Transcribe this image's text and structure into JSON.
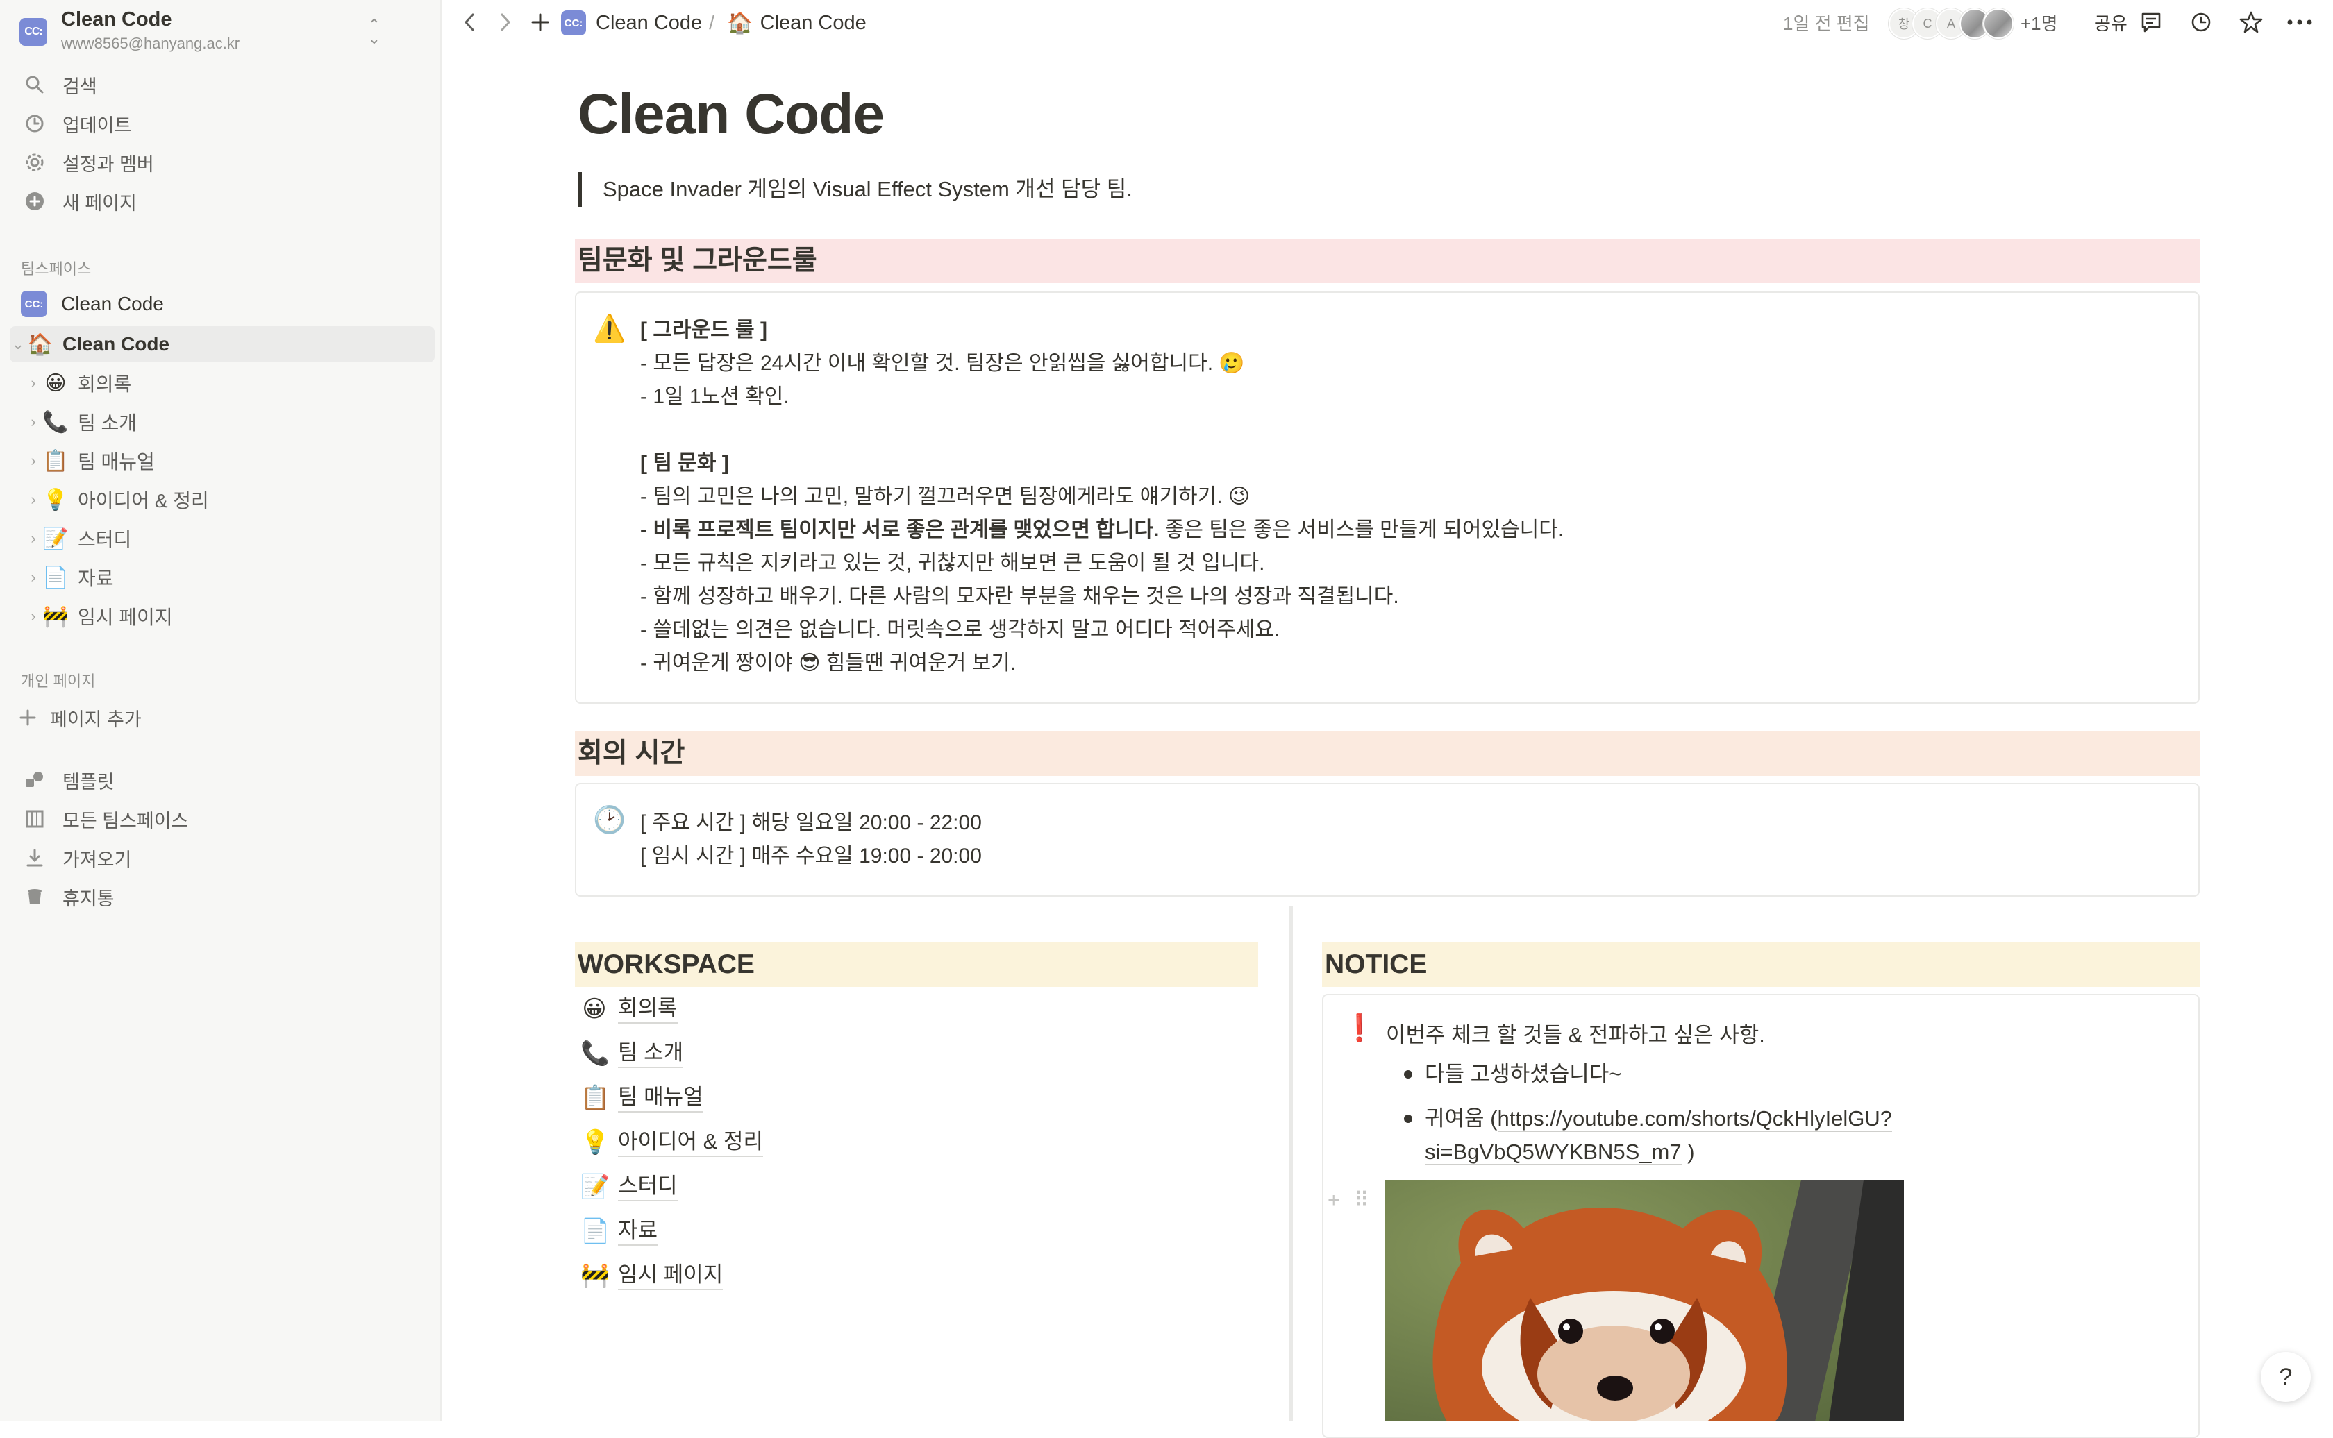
{
  "sidebar": {
    "workspace": {
      "name": "Clean Code",
      "email": "www8565@hanyang.ac.kr",
      "logo_text": "CC:"
    },
    "nav": [
      {
        "label": "검색",
        "icon": "search-icon"
      },
      {
        "label": "업데이트",
        "icon": "clock-icon"
      },
      {
        "label": "설정과 멤버",
        "icon": "gear-icon"
      },
      {
        "label": "새 페이지",
        "icon": "plus-circle-icon"
      }
    ],
    "teamspace_label": "팀스페이스",
    "teamspace_name": "Clean Code",
    "active_page": {
      "emoji": "🏠",
      "label": "Clean Code"
    },
    "children": [
      {
        "emoji": "😀",
        "label": "회의록"
      },
      {
        "emoji": "📞",
        "label": "팀 소개"
      },
      {
        "emoji": "📋",
        "label": "팀 매뉴얼"
      },
      {
        "emoji": "💡",
        "label": "아이디어 & 정리"
      },
      {
        "emoji": "📝",
        "label": "스터디"
      },
      {
        "emoji": "📄",
        "label": "자료"
      },
      {
        "emoji": "🚧",
        "label": "임시 페이지"
      }
    ],
    "private_label": "개인 페이지",
    "add_page_label": "페이지 추가",
    "bottom": [
      {
        "label": "템플릿",
        "icon": "shapes-icon"
      },
      {
        "label": "모든 팀스페이스",
        "icon": "building-icon"
      },
      {
        "label": "가져오기",
        "icon": "download-icon"
      },
      {
        "label": "휴지통",
        "icon": "trash-icon"
      }
    ]
  },
  "topbar": {
    "breadcrumb": [
      {
        "label": "Clean Code",
        "emoji": ""
      },
      {
        "label": "Clean Code",
        "emoji": "🏠"
      }
    ],
    "edited": "1일 전 편집",
    "avatars": [
      "창",
      "C",
      "A"
    ],
    "extra_count": "+1명",
    "share_label": "공유"
  },
  "page": {
    "title": "Clean Code",
    "quote": "Space Invader 게임의 Visual Effect System 개선 담당 팀.",
    "section1": {
      "heading": "팀문화 및 그라운드룰",
      "icon": "⚠️",
      "rule_title": "[ 그라운드 룰 ]",
      "rules": [
        "- 모든 답장은 24시간 이내 확인할 것. 팀장은 안읽씹을 싫어합니다. 🥲",
        "- 1일 1노션 확인."
      ],
      "culture_title": "[ 팀 문화 ]",
      "culture_1": "- 팀의 고민은 나의 고민, 말하기 껄끄러우면 팀장에게라도 얘기하기. 😉",
      "culture_2_bold": "- 비록 프로젝트 팀이지만 서로 좋은 관계를 맺었으면 합니다.",
      "culture_2_rest": " 좋은 팀은 좋은 서비스를 만들게 되어있습니다.",
      "culture_rest": [
        "- 모든 규칙은 지키라고 있는 것, 귀찮지만 해보면 큰 도움이 될 것 입니다.",
        "- 함께 성장하고 배우기. 다른 사람의 모자란 부분을 채우는 것은 나의 성장과 직결됩니다.",
        "- 쓸데없는 의견은 없습니다. 머릿속으로 생각하지 말고 어디다 적어주세요.",
        "- 귀여운게 짱이야 😎 힘들땐 귀여운거 보기."
      ]
    },
    "section2": {
      "heading": "회의 시간",
      "icon": "🕑",
      "lines": [
        "[ 주요 시간 ] 해당 일요일 20:00 - 22:00",
        "[ 임시 시간 ] 매주 수요일 19:00 - 20:00"
      ]
    },
    "workspace": {
      "heading": "WORKSPACE",
      "links": [
        {
          "emoji": "😀",
          "label": "회의록"
        },
        {
          "emoji": "📞",
          "label": "팀 소개"
        },
        {
          "emoji": "📋",
          "label": "팀 매뉴얼"
        },
        {
          "emoji": "💡",
          "label": "아이디어 & 정리"
        },
        {
          "emoji": "📝",
          "label": "스터디"
        },
        {
          "emoji": "📄",
          "label": "자료"
        },
        {
          "emoji": "🚧",
          "label": "임시 페이지"
        }
      ]
    },
    "notice": {
      "heading": "NOTICE",
      "icon": "❗",
      "title": "이번주 체크 할 것들 & 전파하고 싶은 사항.",
      "bullet1": "다들 고생하셨습니다~",
      "bullet2_prefix": "귀여움 (",
      "bullet2_link_line1": "https://youtube.com/shorts/QckHlyIelGU?",
      "bullet2_link_line2": "si=BgVbQ5WYKBN5S_m7",
      "bullet2_suffix": " )"
    },
    "help_label": "?"
  },
  "colors": {
    "sidebar_bg": "#f7f7f5",
    "band_red": "#fbe4e4",
    "band_orange": "#fbeadf",
    "band_yellow": "#fbf3db",
    "logo": "#7b8bd6",
    "text": "#37352f"
  }
}
